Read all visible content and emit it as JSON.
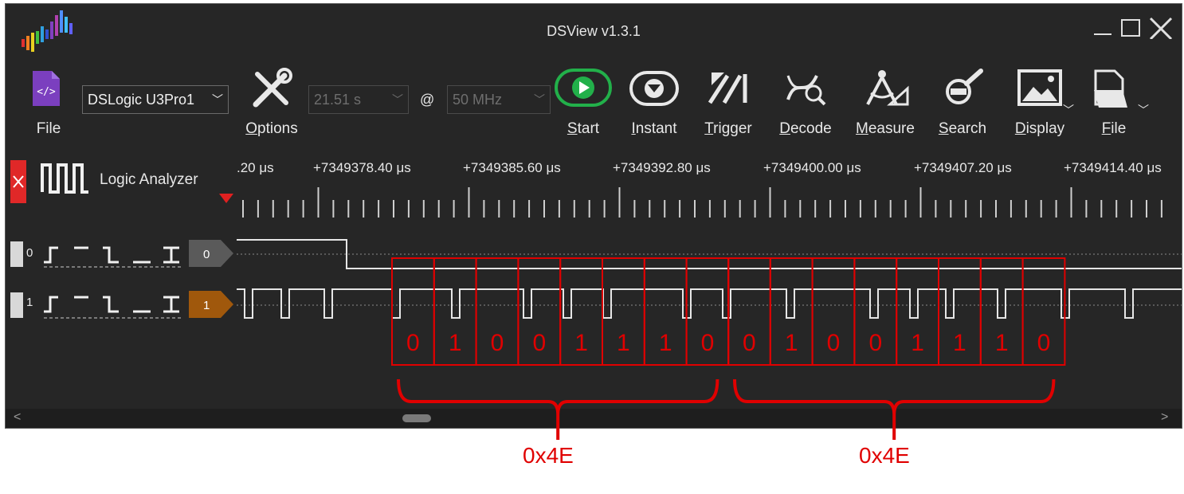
{
  "window": {
    "title": "DSView v1.3.1",
    "minimize": "—",
    "maximize": "☐",
    "close": "✕"
  },
  "toolbar": {
    "file_left": "File",
    "device": "DSLogic U3Pro1",
    "options": "Options",
    "duration": "21.51 s",
    "at": "@",
    "rate": "50 MHz",
    "start": "Start",
    "instant": "Instant",
    "trigger": "Trigger",
    "decode": "Decode",
    "measure": "Measure",
    "search": "Search",
    "display": "Display",
    "file_right": "File",
    "start_color": "#22b04a"
  },
  "panel": {
    "mode_label": "Logic Analyzer"
  },
  "ruler": {
    "labels": [
      ".20 μs",
      "+7349378.40 μs",
      "+7349385.60 μs",
      "+7349392.80 μs",
      "+7349400.00 μs",
      "+7349407.20 μs",
      "+7349414.40 μs"
    ]
  },
  "channels": [
    {
      "index": "0",
      "badge": "0",
      "badge_color": "#5a5a5a"
    },
    {
      "index": "1",
      "badge": "1",
      "badge_color": "#a0580c"
    }
  ],
  "annotation": {
    "color": "#e00000",
    "bits_group1": [
      "0",
      "1",
      "0",
      "0",
      "1",
      "1",
      "1",
      "0"
    ],
    "bits_group2": [
      "0",
      "1",
      "0",
      "0",
      "1",
      "1",
      "1",
      "0"
    ],
    "hex1": "0x4E",
    "hex2": "0x4E"
  }
}
